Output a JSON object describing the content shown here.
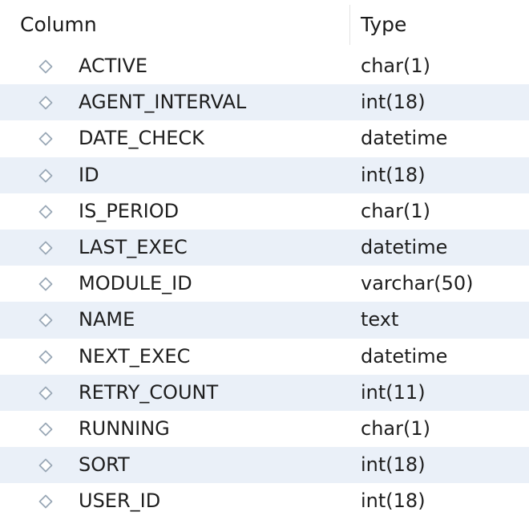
{
  "header": {
    "column_label": "Column",
    "type_label": "Type"
  },
  "colors": {
    "alt_row": "#eaf0f8",
    "icon_stroke": "#9aa8b6"
  },
  "rows": [
    {
      "icon": "diamond-icon",
      "name": "ACTIVE",
      "type": "char(1)"
    },
    {
      "icon": "diamond-icon",
      "name": "AGENT_INTERVAL",
      "type": "int(18)"
    },
    {
      "icon": "diamond-icon",
      "name": "DATE_CHECK",
      "type": "datetime"
    },
    {
      "icon": "diamond-icon",
      "name": "ID",
      "type": "int(18)"
    },
    {
      "icon": "diamond-icon",
      "name": "IS_PERIOD",
      "type": "char(1)"
    },
    {
      "icon": "diamond-icon",
      "name": "LAST_EXEC",
      "type": "datetime"
    },
    {
      "icon": "diamond-icon",
      "name": "MODULE_ID",
      "type": "varchar(50)"
    },
    {
      "icon": "diamond-icon",
      "name": "NAME",
      "type": "text"
    },
    {
      "icon": "diamond-icon",
      "name": "NEXT_EXEC",
      "type": "datetime"
    },
    {
      "icon": "diamond-icon",
      "name": "RETRY_COUNT",
      "type": "int(11)"
    },
    {
      "icon": "diamond-icon",
      "name": "RUNNING",
      "type": "char(1)"
    },
    {
      "icon": "diamond-icon",
      "name": "SORT",
      "type": "int(18)"
    },
    {
      "icon": "diamond-icon",
      "name": "USER_ID",
      "type": "int(18)"
    }
  ]
}
